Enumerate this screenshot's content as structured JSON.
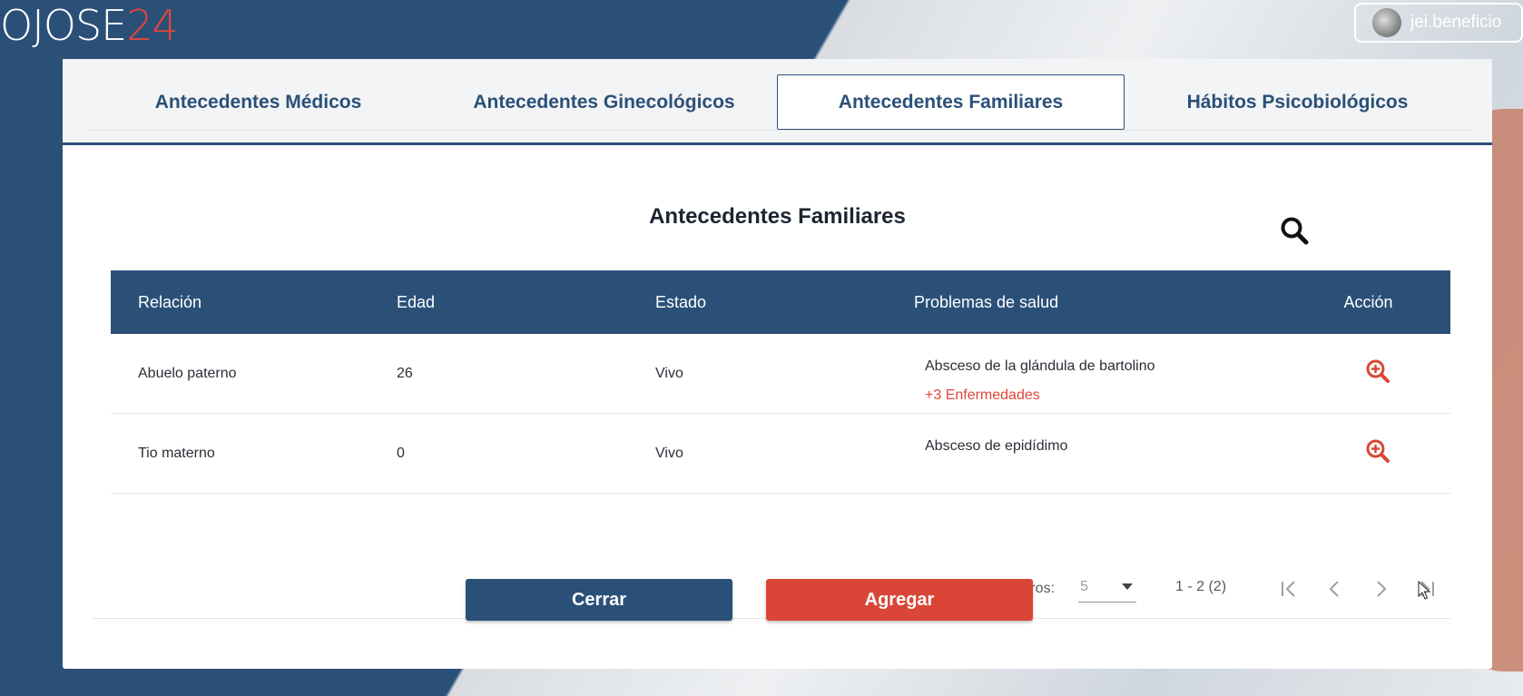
{
  "brand": {
    "logo_main": "OJOSE",
    "logo_accent": "24"
  },
  "user": {
    "name": "jei.beneficio"
  },
  "tabs": [
    {
      "label": "Antecedentes Médicos"
    },
    {
      "label": "Antecedentes Ginecológicos"
    },
    {
      "label": "Antecedentes Familiares"
    },
    {
      "label": "Hábitos Psicobiológicos"
    }
  ],
  "section": {
    "title": "Antecedentes Familiares"
  },
  "table": {
    "headers": [
      "Relación",
      "Edad",
      "Estado",
      "Problemas de salud",
      "Acción"
    ],
    "rows": [
      {
        "relacion": "Abuelo paterno",
        "edad": "26",
        "estado": "Vivo",
        "problema": "Absceso de la glándula de bartolino",
        "mas": "+3 Enfermedades"
      },
      {
        "relacion": "Tio materno",
        "edad": "0",
        "estado": "Vivo",
        "problema": "Absceso de epidídimo",
        "mas": ""
      }
    ]
  },
  "pagination": {
    "label": "Registros:",
    "page_size": "5",
    "range": "1 - 2 (2)"
  },
  "buttons": {
    "close": "Cerrar",
    "add": "Agregar"
  },
  "colors": {
    "primary": "#2b5078",
    "accent": "#d94637"
  },
  "icons": [
    "search-icon",
    "zoom-in-icon",
    "first-page-icon",
    "prev-page-icon",
    "next-page-icon",
    "last-page-icon"
  ]
}
